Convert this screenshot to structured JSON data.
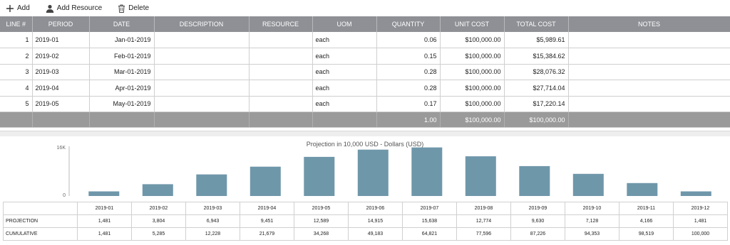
{
  "toolbar": {
    "add_label": "Add",
    "add_resource_label": "Add Resource",
    "delete_label": "Delete"
  },
  "grid": {
    "columns": [
      "LINE #",
      "PERIOD",
      "DATE",
      "DESCRIPTION",
      "RESOURCE",
      "UOM",
      "QUANTITY",
      "UNIT COST",
      "TOTAL COST",
      "NOTES"
    ],
    "rows": [
      {
        "line": "1",
        "period": "2019-01",
        "date": "Jan-01-2019",
        "description": "",
        "resource": "",
        "uom": "each",
        "quantity": "0.06",
        "unit_cost": "$100,000.00",
        "total_cost": "$5,989.61",
        "notes": ""
      },
      {
        "line": "2",
        "period": "2019-02",
        "date": "Feb-01-2019",
        "description": "",
        "resource": "",
        "uom": "each",
        "quantity": "0.15",
        "unit_cost": "$100,000.00",
        "total_cost": "$15,384.62",
        "notes": ""
      },
      {
        "line": "3",
        "period": "2019-03",
        "date": "Mar-01-2019",
        "description": "",
        "resource": "",
        "uom": "each",
        "quantity": "0.28",
        "unit_cost": "$100,000.00",
        "total_cost": "$28,076.32",
        "notes": ""
      },
      {
        "line": "4",
        "period": "2019-04",
        "date": "Apr-01-2019",
        "description": "",
        "resource": "",
        "uom": "each",
        "quantity": "0.28",
        "unit_cost": "$100,000.00",
        "total_cost": "$27,714.04",
        "notes": ""
      },
      {
        "line": "5",
        "period": "2019-05",
        "date": "May-01-2019",
        "description": "",
        "resource": "",
        "uom": "each",
        "quantity": "0.17",
        "unit_cost": "$100,000.00",
        "total_cost": "$17,220.14",
        "notes": ""
      }
    ],
    "totals": {
      "quantity": "1.00",
      "unit_cost": "$100,000.00",
      "total_cost": "$100,000.00"
    }
  },
  "chart_data": {
    "type": "bar",
    "title": "Projection in 10,000 USD - Dollars (USD)",
    "categories": [
      "2019-01",
      "2019-02",
      "2019-03",
      "2019-04",
      "2019-05",
      "2019-06",
      "2019-07",
      "2019-08",
      "2019-09",
      "2019-10",
      "2019-11",
      "2019-12"
    ],
    "values": [
      1481,
      3804,
      6943,
      9451,
      12589,
      14915,
      15638,
      12774,
      9630,
      7128,
      4166,
      1481
    ],
    "ylim": [
      0,
      16000
    ],
    "yticks": [
      "16K",
      "0"
    ],
    "bar_color": "#6f97aa"
  },
  "projection_table": {
    "periods": [
      "2019-01",
      "2019-02",
      "2019-03",
      "2019-04",
      "2019-05",
      "2019-06",
      "2019-07",
      "2019-08",
      "2019-09",
      "2019-10",
      "2019-11",
      "2019-12"
    ],
    "projection_label": "PROJECTION",
    "projection": [
      "1,481",
      "3,804",
      "6,943",
      "9,451",
      "12,589",
      "14,915",
      "15,638",
      "12,774",
      "9,630",
      "7,128",
      "4,166",
      "1,481"
    ],
    "cumulative_label": "CUMULATIVE",
    "cumulative": [
      "1,481",
      "5,285",
      "12,228",
      "21,679",
      "34,268",
      "49,183",
      "64,821",
      "77,596",
      "87,226",
      "94,353",
      "98,519",
      "100,000"
    ]
  }
}
